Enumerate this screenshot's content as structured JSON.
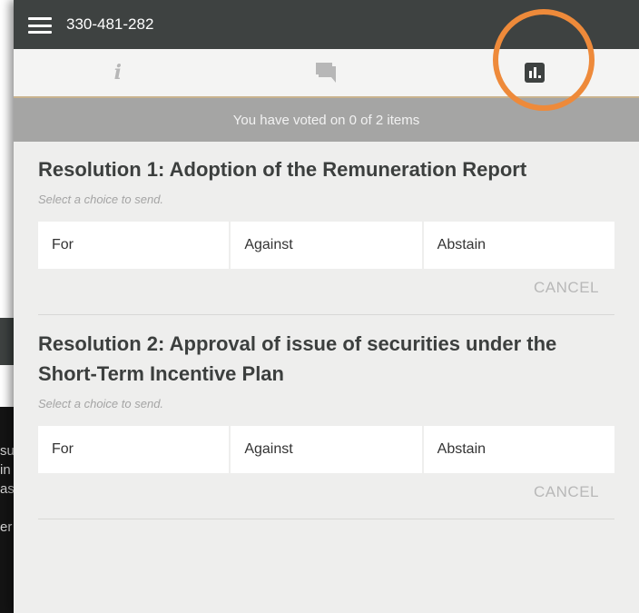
{
  "header": {
    "meeting_id": "330-481-282"
  },
  "tabs": [
    {
      "name": "info",
      "icon": "info-icon",
      "glyph": "i"
    },
    {
      "name": "questions",
      "icon": "chat-icon"
    },
    {
      "name": "voting",
      "icon": "bar-chart-icon"
    }
  ],
  "status_text": "You have voted on 0 of 2 items",
  "resolutions": [
    {
      "title": "Resolution 1: Adoption of the Remuneration Report",
      "hint": "Select a choice to send.",
      "choices": [
        "For",
        "Against",
        "Abstain"
      ],
      "cancel_label": "CANCEL"
    },
    {
      "title": "Resolution 2: Approval of issue of securities under the Short-Term Incentive Plan",
      "hint": "Select a choice to send.",
      "choices": [
        "For",
        "Against",
        "Abstain"
      ],
      "cancel_label": "CANCEL"
    }
  ],
  "background_text_fragments": [
    "sul",
    "in",
    "as",
    "",
    "er"
  ],
  "colors": {
    "topbar": "#3e4241",
    "panel_bg": "#eeeeed",
    "status_bar": "#a5a5a4",
    "highlight_ring": "#ee8a3a",
    "tab_underline": "#c9b38e"
  }
}
